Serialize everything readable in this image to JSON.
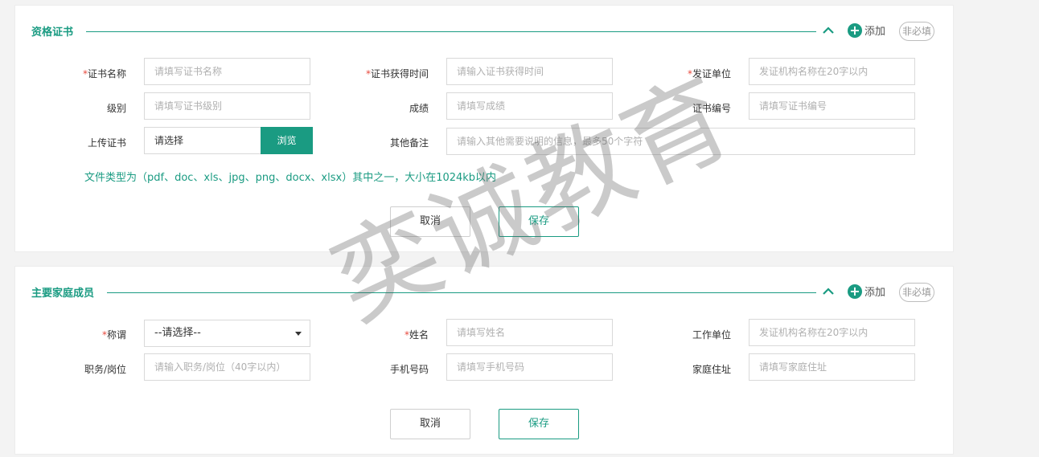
{
  "cert_section": {
    "title": "资格证书",
    "add_label": "添加",
    "optional_label": "非必填",
    "fields": {
      "name_label": "证书名称",
      "name_placeholder": "请填写证书名称",
      "date_label": "证书获得时间",
      "date_placeholder": "请输入证书获得时间",
      "issuer_label": "发证单位",
      "issuer_placeholder": "发证机构名称在20字以内",
      "level_label": "级别",
      "level_placeholder": "请填写证书级别",
      "score_label": "成绩",
      "score_placeholder": "请填写成绩",
      "number_label": "证书编号",
      "number_placeholder": "请填写证书编号",
      "upload_label": "上传证书",
      "upload_value": "请选择",
      "browse_label": "浏览",
      "remark_label": "其他备注",
      "remark_placeholder": "请输入其他需要说明的信息，最多50个字符"
    },
    "hint": "文件类型为（pdf、doc、xls、jpg、png、docx、xlsx）其中之一，大小在1024kb以内",
    "cancel_label": "取消",
    "save_label": "保存"
  },
  "family_section": {
    "title": "主要家庭成员",
    "add_label": "添加",
    "optional_label": "非必填",
    "fields": {
      "relation_label": "称谓",
      "relation_value": "--请选择--",
      "name_label": "姓名",
      "name_placeholder": "请填写姓名",
      "employer_label": "工作单位",
      "employer_placeholder": "发证机构名称在20字以内",
      "position_label": "职务/岗位",
      "position_placeholder": "请输入职务/岗位（40字以内）",
      "phone_label": "手机号码",
      "phone_placeholder": "请填写手机号码",
      "address_label": "家庭住址",
      "address_placeholder": "请填写家庭住址"
    },
    "cancel_label": "取消",
    "save_label": "保存"
  },
  "required_mark": "*",
  "watermark": "奕诚教育",
  "colors": {
    "accent": "#1a9b82",
    "required": "#e84a3e"
  }
}
